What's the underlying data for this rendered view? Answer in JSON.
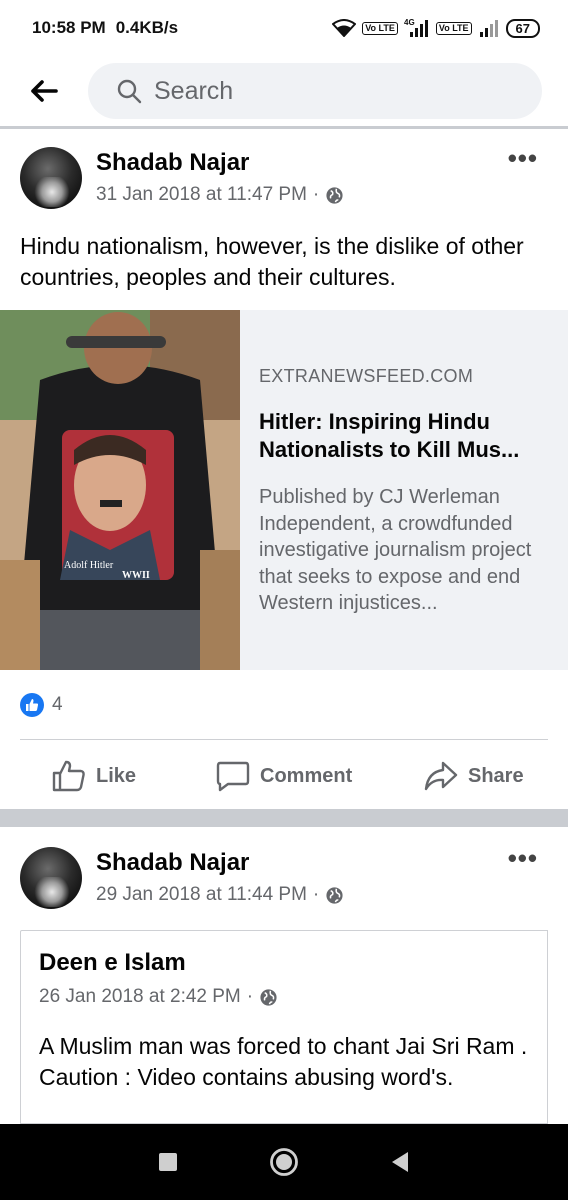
{
  "status_bar": {
    "time": "10:58 PM",
    "net_speed": "0.4KB/s",
    "lte1": "Vo LTE",
    "net_type": "4G",
    "lte2": "Vo LTE",
    "battery": "67"
  },
  "header": {
    "search_placeholder": "Search"
  },
  "posts": [
    {
      "author": "Shadab Najar",
      "timestamp": "31 Jan 2018 at 11:47 PM",
      "privacy_icon": "globe-icon",
      "text": "Hindu nationalism, however, is the dislike of other countries, peoples and their cultures.",
      "link": {
        "domain": "EXTRANEWSFEED.COM",
        "title": "Hitler: Inspiring Hindu Nationalists to Kill Mus...",
        "description": "Published by CJ Werleman Independent, a crowdfunded investigative journalism project that seeks to expose and end Western injustices...",
        "image_caption_1": "Adolf Hitler",
        "image_caption_2": "WWII"
      },
      "reaction_count": "4",
      "actions": {
        "like": "Like",
        "comment": "Comment",
        "share": "Share"
      }
    },
    {
      "author": "Shadab Najar",
      "timestamp": "29 Jan 2018 at 11:44 PM",
      "privacy_icon": "globe-icon",
      "shared": {
        "author": "Deen e Islam",
        "timestamp": "26 Jan 2018 at 2:42 PM",
        "text_line1": "A Muslim man was forced to chant Jai Sri Ram .",
        "text_line2": "Caution : Video contains abusing word's."
      }
    }
  ],
  "colors": {
    "accent": "#1877f2",
    "secondary_text": "#65676b",
    "divider": "#c9ccd1"
  }
}
